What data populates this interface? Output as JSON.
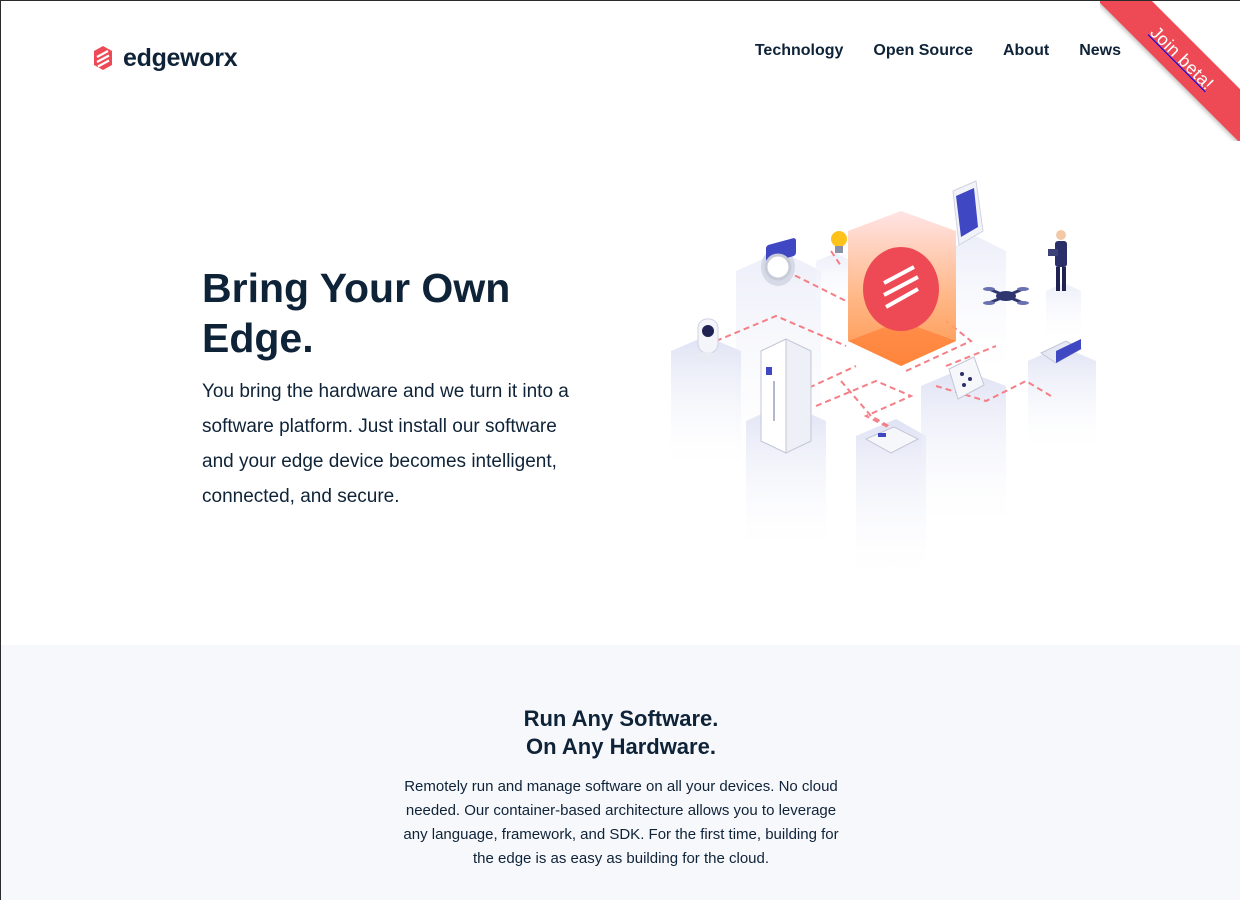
{
  "brand": {
    "name": "edgeworx",
    "color": "#ee4a55",
    "ink": "#0f2338"
  },
  "nav": [
    {
      "label": "Technology"
    },
    {
      "label": "Open Source"
    },
    {
      "label": "About"
    },
    {
      "label": "News"
    }
  ],
  "ribbon": {
    "label": "Join beta!"
  },
  "hero": {
    "title": "Bring Your Own Edge.",
    "text": "You bring the hardware and we turn it into a software platform. Just install our software and your edge device becomes intelligent, connected, and secure."
  },
  "section2": {
    "title_line1": "Run Any Software.",
    "title_line2": "On Any Hardware.",
    "text": "Remotely run and manage software on all your devices. No cloud needed. Our container-based architecture allows you to leverage any language, framework, and SDK. For the first time, building for the edge is as easy as building for the cloud."
  },
  "icons": [
    "edgeworx-logo-icon",
    "isometric-devices-illustration"
  ]
}
